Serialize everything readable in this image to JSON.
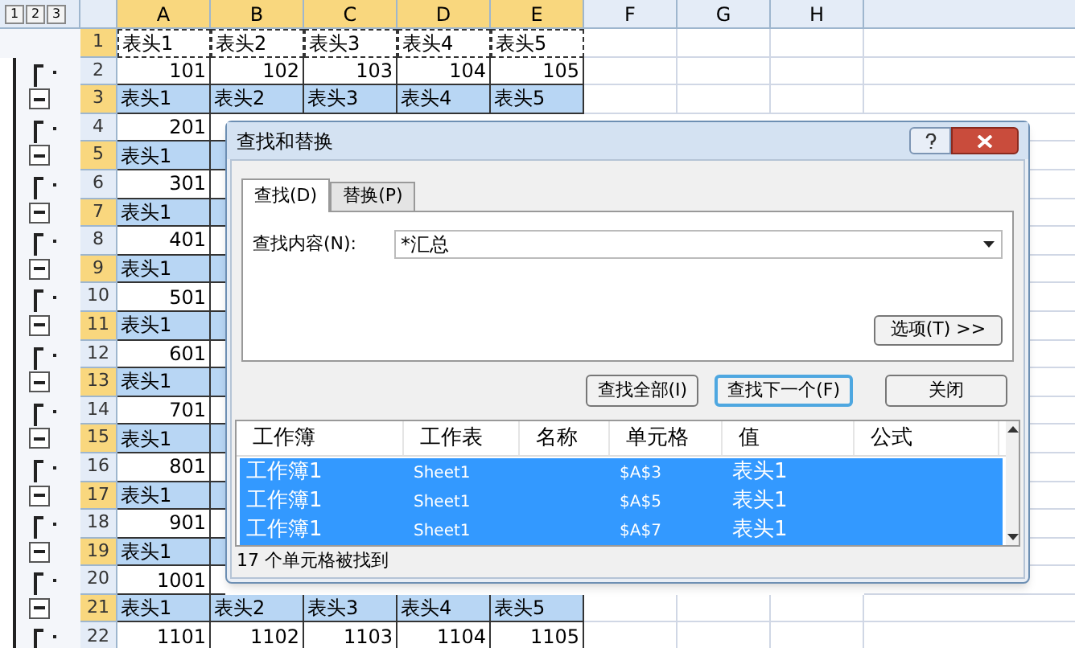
{
  "outline_levels": [
    "1",
    "2",
    "3"
  ],
  "columns": [
    {
      "label": "A",
      "selected": true
    },
    {
      "label": "B",
      "selected": true
    },
    {
      "label": "C",
      "selected": true
    },
    {
      "label": "D",
      "selected": true
    },
    {
      "label": "E",
      "selected": true
    },
    {
      "label": "F",
      "selected": false
    },
    {
      "label": "G",
      "selected": false
    },
    {
      "label": "H",
      "selected": false
    }
  ],
  "rows": [
    {
      "number": "1",
      "kind": "header",
      "selected": true,
      "copy_marquee": true,
      "cells": [
        "表头1",
        "表头2",
        "表头3",
        "表头4",
        "表头5"
      ]
    },
    {
      "number": "2",
      "kind": "data",
      "selected": false,
      "copy_marquee": false,
      "cells": [
        "101",
        "102",
        "103",
        "104",
        "105"
      ]
    },
    {
      "number": "3",
      "kind": "summary",
      "selected": true,
      "copy_marquee": false,
      "cells": [
        "表头1",
        "表头2",
        "表头3",
        "表头4",
        "表头5"
      ]
    },
    {
      "number": "4",
      "kind": "data",
      "selected": false,
      "copy_marquee": false,
      "cells": [
        "201"
      ]
    },
    {
      "number": "5",
      "kind": "summary",
      "selected": true,
      "copy_marquee": false,
      "cells": [
        "表头1"
      ]
    },
    {
      "number": "6",
      "kind": "data",
      "selected": false,
      "copy_marquee": false,
      "cells": [
        "301"
      ]
    },
    {
      "number": "7",
      "kind": "summary",
      "selected": true,
      "copy_marquee": false,
      "cells": [
        "表头1"
      ]
    },
    {
      "number": "8",
      "kind": "data",
      "selected": false,
      "copy_marquee": false,
      "cells": [
        "401"
      ]
    },
    {
      "number": "9",
      "kind": "summary",
      "selected": true,
      "copy_marquee": false,
      "cells": [
        "表头1"
      ]
    },
    {
      "number": "10",
      "kind": "data",
      "selected": false,
      "copy_marquee": false,
      "cells": [
        "501"
      ]
    },
    {
      "number": "11",
      "kind": "summary",
      "selected": true,
      "copy_marquee": false,
      "cells": [
        "表头1"
      ]
    },
    {
      "number": "12",
      "kind": "data",
      "selected": false,
      "copy_marquee": false,
      "cells": [
        "601"
      ]
    },
    {
      "number": "13",
      "kind": "summary",
      "selected": true,
      "copy_marquee": false,
      "cells": [
        "表头1"
      ]
    },
    {
      "number": "14",
      "kind": "data",
      "selected": false,
      "copy_marquee": false,
      "cells": [
        "701"
      ]
    },
    {
      "number": "15",
      "kind": "summary",
      "selected": true,
      "copy_marquee": false,
      "cells": [
        "表头1"
      ]
    },
    {
      "number": "16",
      "kind": "data",
      "selected": false,
      "copy_marquee": false,
      "cells": [
        "801"
      ]
    },
    {
      "number": "17",
      "kind": "summary",
      "selected": true,
      "copy_marquee": false,
      "cells": [
        "表头1"
      ]
    },
    {
      "number": "18",
      "kind": "data",
      "selected": false,
      "copy_marquee": false,
      "cells": [
        "901"
      ]
    },
    {
      "number": "19",
      "kind": "summary",
      "selected": true,
      "copy_marquee": false,
      "cells": [
        "表头1"
      ]
    },
    {
      "number": "20",
      "kind": "data",
      "selected": false,
      "copy_marquee": false,
      "cells": [
        "1001"
      ]
    },
    {
      "number": "21",
      "kind": "summary",
      "selected": true,
      "copy_marquee": false,
      "cells": [
        "表头1",
        "表头2",
        "表头3",
        "表头4",
        "表头5"
      ]
    },
    {
      "number": "22",
      "kind": "data",
      "selected": false,
      "copy_marquee": false,
      "cells": [
        "1101",
        "1102",
        "1103",
        "1104",
        "1105"
      ]
    }
  ],
  "dialog": {
    "title": "查找和替换",
    "tabs": [
      {
        "label": "查找(D)",
        "selected": true
      },
      {
        "label": "替换(P)",
        "selected": false
      }
    ],
    "find_label": "查找内容(N):",
    "find_value": "*汇总",
    "options_button": "选项(T) >>",
    "buttons": [
      {
        "label": "查找全部(I)",
        "focused": false
      },
      {
        "label": "查找下一个(F)",
        "focused": true
      },
      {
        "label": "关闭",
        "focused": false
      }
    ],
    "results": {
      "columns": [
        "工作簿",
        "工作表",
        "名称",
        "单元格",
        "值",
        "公式"
      ],
      "rows": [
        {
          "selected": true,
          "cells": [
            "工作簿1",
            "Sheet1",
            "",
            "$A$3",
            "表头1",
            ""
          ]
        },
        {
          "selected": true,
          "cells": [
            "工作簿1",
            "Sheet1",
            "",
            "$A$5",
            "表头1",
            ""
          ]
        },
        {
          "selected": true,
          "cells": [
            "工作簿1",
            "Sheet1",
            "",
            "$A$7",
            "表头1",
            ""
          ]
        }
      ]
    },
    "status": "17 个单元格被找到"
  }
}
